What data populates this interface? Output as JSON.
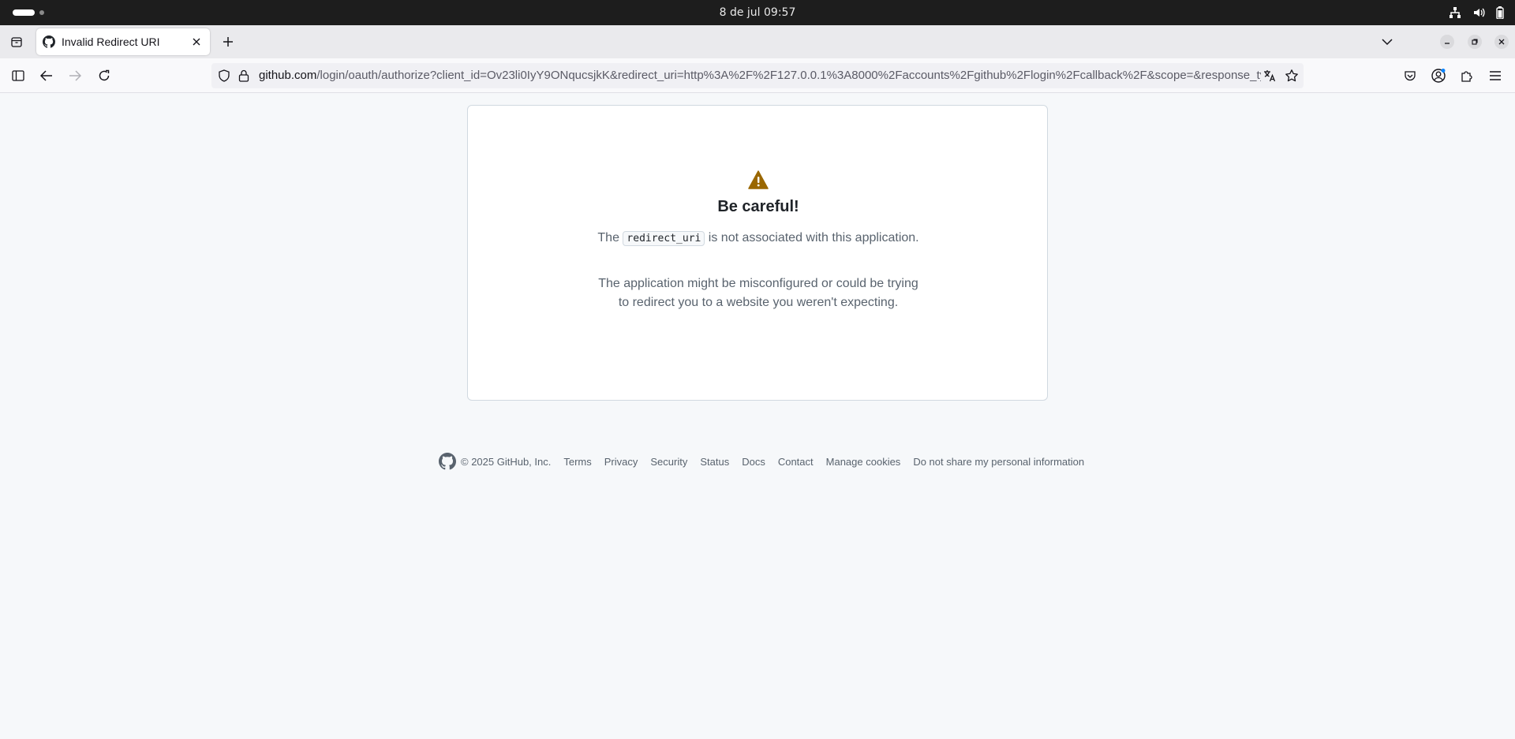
{
  "system_bar": {
    "clock": "8 de jul  09:57",
    "tray_icons": [
      "network-icon",
      "volume-icon",
      "battery-icon"
    ]
  },
  "browser": {
    "tab": {
      "title": "Invalid Redirect URI",
      "favicon": "github-icon"
    },
    "url": {
      "host": "github.com",
      "path": "/login/oauth/authorize?client_id=Ov23li0IyY9ONqucsjkK&redirect_uri=http%3A%2F%2F127.0.0.1%3A8000%2Faccounts%2Fgithub%2Flogin%2Fcallback%2F&scope=&response_type=code&state"
    }
  },
  "page": {
    "title": "Be careful!",
    "message_prefix": "The",
    "message_code": "redirect_uri",
    "message_suffix": "is not associated with this application.",
    "detail": "The application might be misconfigured or could be trying to redirect you to a website you weren't expecting.",
    "alert_color": "#9a6700"
  },
  "footer": {
    "copyright": "© 2025 GitHub, Inc.",
    "links": [
      "Terms",
      "Privacy",
      "Security",
      "Status",
      "Docs",
      "Contact",
      "Manage cookies",
      "Do not share my personal information"
    ]
  }
}
